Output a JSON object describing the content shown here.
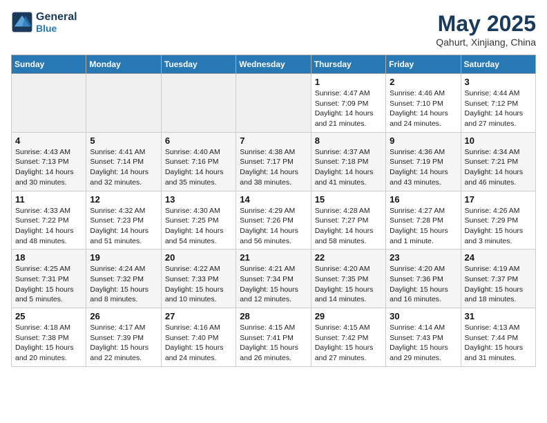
{
  "header": {
    "logo_line1": "General",
    "logo_line2": "Blue",
    "month": "May 2025",
    "location": "Qahurt, Xinjiang, China"
  },
  "days_of_week": [
    "Sunday",
    "Monday",
    "Tuesday",
    "Wednesday",
    "Thursday",
    "Friday",
    "Saturday"
  ],
  "weeks": [
    [
      {
        "day": "",
        "empty": true
      },
      {
        "day": "",
        "empty": true
      },
      {
        "day": "",
        "empty": true
      },
      {
        "day": "",
        "empty": true
      },
      {
        "day": "1",
        "lines": [
          "Sunrise: 4:47 AM",
          "Sunset: 7:09 PM",
          "Daylight: 14 hours",
          "and 21 minutes."
        ]
      },
      {
        "day": "2",
        "lines": [
          "Sunrise: 4:46 AM",
          "Sunset: 7:10 PM",
          "Daylight: 14 hours",
          "and 24 minutes."
        ]
      },
      {
        "day": "3",
        "lines": [
          "Sunrise: 4:44 AM",
          "Sunset: 7:12 PM",
          "Daylight: 14 hours",
          "and 27 minutes."
        ]
      }
    ],
    [
      {
        "day": "4",
        "lines": [
          "Sunrise: 4:43 AM",
          "Sunset: 7:13 PM",
          "Daylight: 14 hours",
          "and 30 minutes."
        ]
      },
      {
        "day": "5",
        "lines": [
          "Sunrise: 4:41 AM",
          "Sunset: 7:14 PM",
          "Daylight: 14 hours",
          "and 32 minutes."
        ]
      },
      {
        "day": "6",
        "lines": [
          "Sunrise: 4:40 AM",
          "Sunset: 7:16 PM",
          "Daylight: 14 hours",
          "and 35 minutes."
        ]
      },
      {
        "day": "7",
        "lines": [
          "Sunrise: 4:38 AM",
          "Sunset: 7:17 PM",
          "Daylight: 14 hours",
          "and 38 minutes."
        ]
      },
      {
        "day": "8",
        "lines": [
          "Sunrise: 4:37 AM",
          "Sunset: 7:18 PM",
          "Daylight: 14 hours",
          "and 41 minutes."
        ]
      },
      {
        "day": "9",
        "lines": [
          "Sunrise: 4:36 AM",
          "Sunset: 7:19 PM",
          "Daylight: 14 hours",
          "and 43 minutes."
        ]
      },
      {
        "day": "10",
        "lines": [
          "Sunrise: 4:34 AM",
          "Sunset: 7:21 PM",
          "Daylight: 14 hours",
          "and 46 minutes."
        ]
      }
    ],
    [
      {
        "day": "11",
        "lines": [
          "Sunrise: 4:33 AM",
          "Sunset: 7:22 PM",
          "Daylight: 14 hours",
          "and 48 minutes."
        ]
      },
      {
        "day": "12",
        "lines": [
          "Sunrise: 4:32 AM",
          "Sunset: 7:23 PM",
          "Daylight: 14 hours",
          "and 51 minutes."
        ]
      },
      {
        "day": "13",
        "lines": [
          "Sunrise: 4:30 AM",
          "Sunset: 7:25 PM",
          "Daylight: 14 hours",
          "and 54 minutes."
        ]
      },
      {
        "day": "14",
        "lines": [
          "Sunrise: 4:29 AM",
          "Sunset: 7:26 PM",
          "Daylight: 14 hours",
          "and 56 minutes."
        ]
      },
      {
        "day": "15",
        "lines": [
          "Sunrise: 4:28 AM",
          "Sunset: 7:27 PM",
          "Daylight: 14 hours",
          "and 58 minutes."
        ]
      },
      {
        "day": "16",
        "lines": [
          "Sunrise: 4:27 AM",
          "Sunset: 7:28 PM",
          "Daylight: 15 hours",
          "and 1 minute."
        ]
      },
      {
        "day": "17",
        "lines": [
          "Sunrise: 4:26 AM",
          "Sunset: 7:29 PM",
          "Daylight: 15 hours",
          "and 3 minutes."
        ]
      }
    ],
    [
      {
        "day": "18",
        "lines": [
          "Sunrise: 4:25 AM",
          "Sunset: 7:31 PM",
          "Daylight: 15 hours",
          "and 5 minutes."
        ]
      },
      {
        "day": "19",
        "lines": [
          "Sunrise: 4:24 AM",
          "Sunset: 7:32 PM",
          "Daylight: 15 hours",
          "and 8 minutes."
        ]
      },
      {
        "day": "20",
        "lines": [
          "Sunrise: 4:22 AM",
          "Sunset: 7:33 PM",
          "Daylight: 15 hours",
          "and 10 minutes."
        ]
      },
      {
        "day": "21",
        "lines": [
          "Sunrise: 4:21 AM",
          "Sunset: 7:34 PM",
          "Daylight: 15 hours",
          "and 12 minutes."
        ]
      },
      {
        "day": "22",
        "lines": [
          "Sunrise: 4:20 AM",
          "Sunset: 7:35 PM",
          "Daylight: 15 hours",
          "and 14 minutes."
        ]
      },
      {
        "day": "23",
        "lines": [
          "Sunrise: 4:20 AM",
          "Sunset: 7:36 PM",
          "Daylight: 15 hours",
          "and 16 minutes."
        ]
      },
      {
        "day": "24",
        "lines": [
          "Sunrise: 4:19 AM",
          "Sunset: 7:37 PM",
          "Daylight: 15 hours",
          "and 18 minutes."
        ]
      }
    ],
    [
      {
        "day": "25",
        "lines": [
          "Sunrise: 4:18 AM",
          "Sunset: 7:38 PM",
          "Daylight: 15 hours",
          "and 20 minutes."
        ]
      },
      {
        "day": "26",
        "lines": [
          "Sunrise: 4:17 AM",
          "Sunset: 7:39 PM",
          "Daylight: 15 hours",
          "and 22 minutes."
        ]
      },
      {
        "day": "27",
        "lines": [
          "Sunrise: 4:16 AM",
          "Sunset: 7:40 PM",
          "Daylight: 15 hours",
          "and 24 minutes."
        ]
      },
      {
        "day": "28",
        "lines": [
          "Sunrise: 4:15 AM",
          "Sunset: 7:41 PM",
          "Daylight: 15 hours",
          "and 26 minutes."
        ]
      },
      {
        "day": "29",
        "lines": [
          "Sunrise: 4:15 AM",
          "Sunset: 7:42 PM",
          "Daylight: 15 hours",
          "and 27 minutes."
        ]
      },
      {
        "day": "30",
        "lines": [
          "Sunrise: 4:14 AM",
          "Sunset: 7:43 PM",
          "Daylight: 15 hours",
          "and 29 minutes."
        ]
      },
      {
        "day": "31",
        "lines": [
          "Sunrise: 4:13 AM",
          "Sunset: 7:44 PM",
          "Daylight: 15 hours",
          "and 31 minutes."
        ]
      }
    ]
  ]
}
